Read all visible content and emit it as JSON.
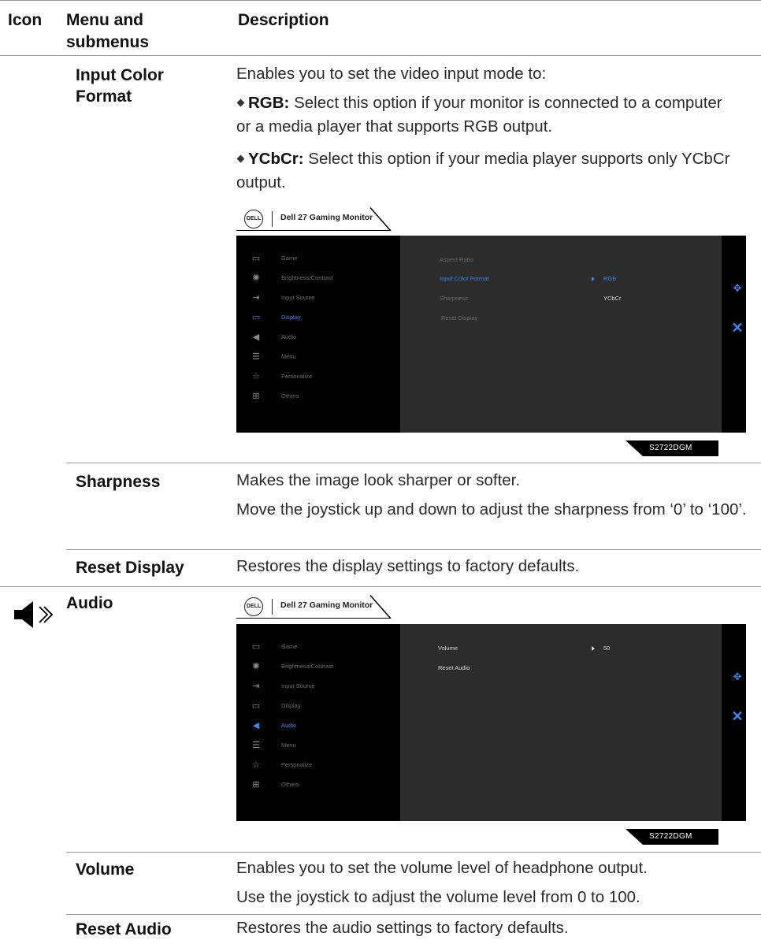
{
  "table": {
    "headers": {
      "icon": "Icon",
      "menu": "Menu and submenus",
      "description": "Description"
    }
  },
  "rows": {
    "input_color_format": {
      "name": "Input Color Format",
      "intro": "Enables you to set the video input mode to:",
      "bullets": [
        {
          "term": "RGB:",
          "text": " Select this option if your monitor is connected to a computer or a media player that supports RGB output."
        },
        {
          "term": "YCbCr:",
          "text": " Select this option if your media player supports only YCbCr output."
        }
      ]
    },
    "sharpness": {
      "name": "Sharpness",
      "desc1": "Makes the image look sharper or softer.",
      "desc2": "Move the joystick up and down to adjust the sharpness from ‘0’ to ‘100’."
    },
    "reset_display": {
      "name": "Reset Display",
      "desc": "Restores the display settings to factory defaults."
    },
    "audio": {
      "name": "Audio",
      "icon": "speaker-icon"
    },
    "volume": {
      "name": "Volume",
      "desc1": "Enables you to set the volume level of headphone output.",
      "desc2": "Use the joystick to adjust the volume level from 0 to 100."
    },
    "reset_audio": {
      "name": "Reset Audio",
      "desc": "Restores the audio settings to factory defaults."
    }
  },
  "osd": {
    "logo": "DELL",
    "title": "Dell 27 Gaming Monitor",
    "model": "S2722DGM",
    "accent_color": "#2d8cf0",
    "menu_items": [
      {
        "label": "Game",
        "icon": "game-icon"
      },
      {
        "label": "Brightness/Contrast",
        "icon": "brightness-icon"
      },
      {
        "label": "Input Source",
        "icon": "input-source-icon"
      },
      {
        "label": "Display",
        "icon": "display-icon"
      },
      {
        "label": "Audio",
        "icon": "audio-icon"
      },
      {
        "label": "Menu",
        "icon": "menu-icon"
      },
      {
        "label": "Personalize",
        "icon": "star-icon"
      },
      {
        "label": "Others",
        "icon": "others-icon"
      }
    ],
    "display_screen": {
      "active_item": "Display",
      "submenu": [
        "Aspect Ratio",
        "Input Color Format",
        "Sharpness",
        "Reset Display"
      ],
      "selected": "Input Color Format",
      "options": [
        "RGB",
        "YCbCr"
      ],
      "selected_option": "RGB"
    },
    "audio_screen": {
      "active_item": "Audio",
      "submenu": [
        "Volume",
        "Reset Audio"
      ],
      "volume_value": "50"
    }
  }
}
